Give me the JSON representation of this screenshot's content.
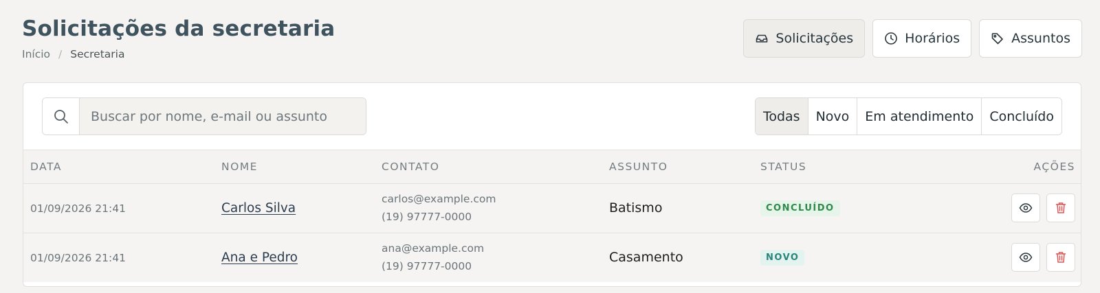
{
  "page": {
    "title": "Solicitações da secretaria",
    "breadcrumb": {
      "home": "Início",
      "separator": "/",
      "current": "Secretaria"
    }
  },
  "header_actions": [
    {
      "label": "Solicitações",
      "icon": "inbox-icon",
      "active": true
    },
    {
      "label": "Horários",
      "icon": "clock-icon",
      "active": false
    },
    {
      "label": "Assuntos",
      "icon": "tag-icon",
      "active": false
    }
  ],
  "search": {
    "placeholder": "Buscar por nome, e-mail ou assunto",
    "value": ""
  },
  "filters": [
    "Todas",
    "Novo",
    "Em atendimento",
    "Concluído"
  ],
  "selected_filter": "Todas",
  "table": {
    "columns": {
      "date": "DATA",
      "name": "NOME",
      "contact": "CONTATO",
      "subject": "ASSUNTO",
      "status": "STATUS",
      "actions": "AÇÕES"
    },
    "rows": [
      {
        "date": "01/09/2026 21:41",
        "name": "Carlos Silva",
        "email": "carlos@example.com",
        "phone": "(19) 97777-0000",
        "subject": "Batismo",
        "status": "CONCLUÍDO"
      },
      {
        "date": "01/09/2026 21:41",
        "name": "Ana e Pedro",
        "email": "ana@example.com",
        "phone": "(19) 97777-0000",
        "subject": "Casamento",
        "status": "NOVO"
      }
    ]
  },
  "colors": {
    "status_concluido_text": "#2f8a4a",
    "status_concluido_bg": "#e6f4ea",
    "status_novo_text": "#2a8479",
    "status_novo_bg": "#e2f3f0",
    "delete_icon": "#e05555"
  }
}
